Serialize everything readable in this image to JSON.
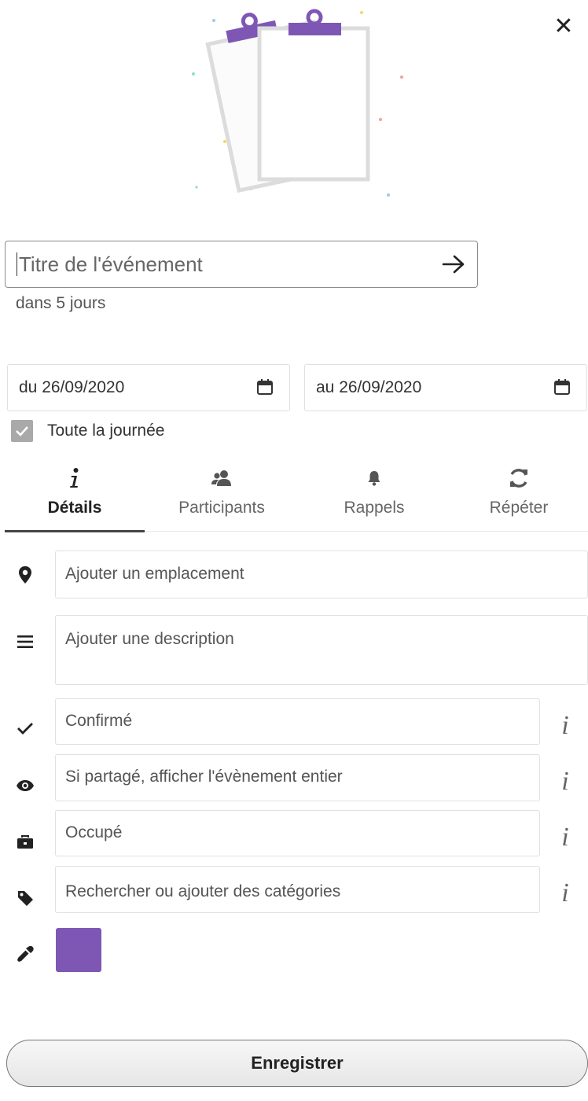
{
  "colors": {
    "accent": "#7e57b5",
    "clipboard_stroke": "#dcdcdc"
  },
  "close": {
    "icon": "close-icon",
    "glyph": "✕"
  },
  "title": {
    "placeholder": "Titre de l'événement",
    "value": "",
    "submit_icon": "arrow-right-icon"
  },
  "relative_time": "dans 5 jours",
  "dates": {
    "start": "du 26/09/2020",
    "end": "au 26/09/2020",
    "icon": "calendar-icon"
  },
  "all_day": {
    "label": "Toute la journée",
    "checked": true
  },
  "tabs": [
    {
      "label": "Détails",
      "icon": "info-icon",
      "active": true
    },
    {
      "label": "Participants",
      "icon": "people-icon",
      "active": false
    },
    {
      "label": "Rappels",
      "icon": "bell-icon",
      "active": false
    },
    {
      "label": "Répéter",
      "icon": "repeat-icon",
      "active": false
    }
  ],
  "details": {
    "location_placeholder": "Ajouter un emplacement",
    "description_placeholder": "Ajouter une description",
    "status": "Confirmé",
    "visibility": "Si partagé, afficher l'évènement entier",
    "availability": "Occupé",
    "categories_placeholder": "Rechercher ou ajouter des catégories",
    "info_glyph": "i"
  },
  "save_label": "Enregistrer"
}
